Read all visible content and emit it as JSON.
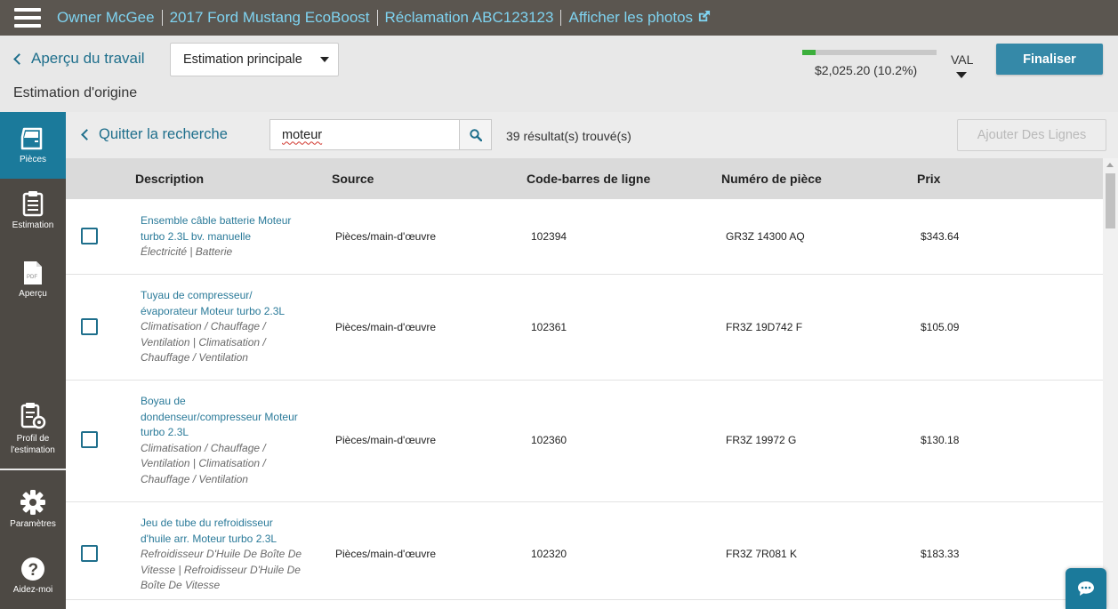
{
  "topbar": {
    "crumbs": [
      "Owner McGee",
      "2017 Ford Mustang EcoBoost",
      "Réclamation ABC123123",
      "Afficher les photos"
    ]
  },
  "header": {
    "back_label": "Aperçu du travail",
    "subtitle": "Estimation d'origine",
    "estimate_select": "Estimation principale",
    "total": "$2,025.20 (10.2%)",
    "progress": 0.102,
    "val_label": "VAL",
    "finalise_label": "Finaliser"
  },
  "sidebar": {
    "items": [
      {
        "label": "Pièces",
        "icon": "door-icon"
      },
      {
        "label": "Estimation",
        "icon": "clipboard-icon"
      },
      {
        "label": "Aperçu",
        "icon": "pdf-icon"
      },
      {
        "label": "Profil de l'estimation",
        "icon": "clipboard-gear-icon"
      },
      {
        "label": "Paramètres",
        "icon": "gear-icon"
      },
      {
        "label": "Aidez-moi",
        "icon": "help-icon"
      }
    ]
  },
  "search": {
    "quit_label": "Quitter la recherche",
    "query": "moteur",
    "results": "39 résultat(s) trouvé(s)",
    "add_lines_label": "Ajouter Des Lignes"
  },
  "table": {
    "headers": {
      "description": "Description",
      "source": "Source",
      "barcode": "Code-barres de ligne",
      "part_number": "Numéro de pièce",
      "price": "Prix"
    },
    "rows": [
      {
        "title": "Ensemble câble batterie Moteur turbo 2.3L bv. manuelle",
        "category": "Électricité | Batterie",
        "source": "Pièces/main-d'œuvre",
        "barcode": "102394",
        "part": "GR3Z 14300 AQ",
        "price": "$343.64"
      },
      {
        "title": "Tuyau de compresseur/ évaporateur Moteur turbo 2.3L",
        "category": "Climatisation / Chauffage / Ventilation | Climatisation / Chauffage / Ventilation",
        "source": "Pièces/main-d'œuvre",
        "barcode": "102361",
        "part": "FR3Z 19D742 F",
        "price": "$105.09"
      },
      {
        "title": "Boyau de dondenseur/compresseur Moteur turbo 2.3L",
        "category": "Climatisation / Chauffage / Ventilation | Climatisation / Chauffage / Ventilation",
        "source": "Pièces/main-d'œuvre",
        "barcode": "102360",
        "part": "FR3Z 19972 G",
        "price": "$130.18"
      },
      {
        "title": "Jeu de tube du refroidisseur d'huile arr. Moteur turbo 2.3L",
        "category": "Refroidisseur D'Huile De Boîte De Vitesse | Refroidisseur D'Huile De Boîte De Vitesse",
        "source": "Pièces/main-d'œuvre",
        "barcode": "102320",
        "part": "FR3Z 7R081 K",
        "price": "$183.33"
      }
    ]
  }
}
